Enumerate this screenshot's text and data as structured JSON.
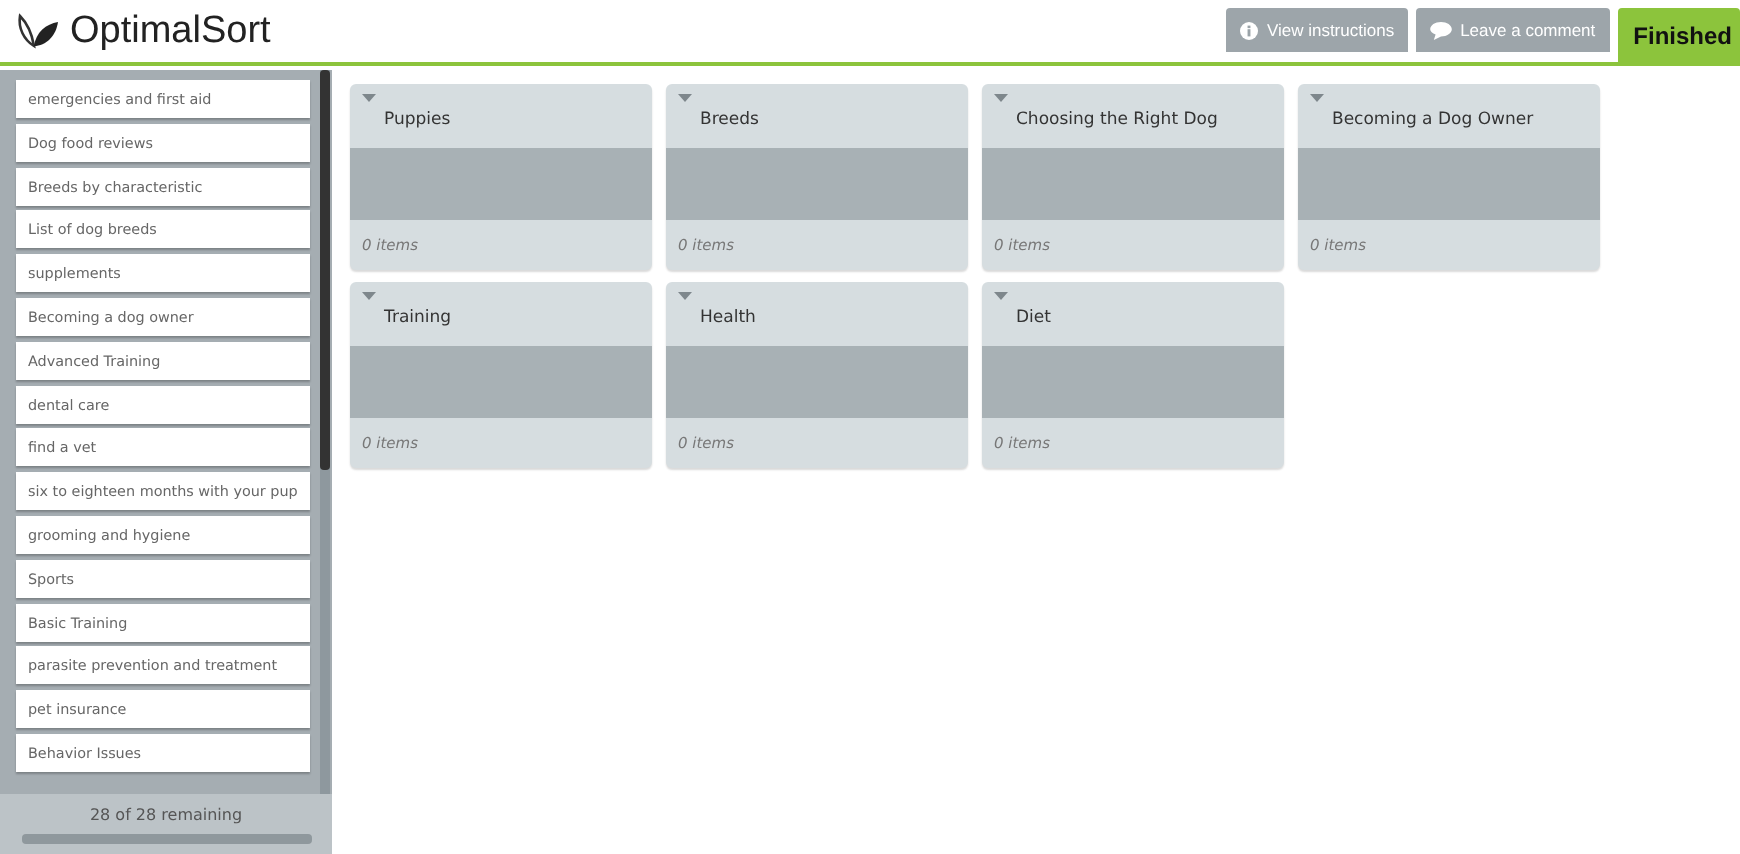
{
  "header": {
    "logo": "OptimalSort",
    "buttons": [
      {
        "kind": "info",
        "label": "View instructions"
      },
      {
        "kind": "comment",
        "label": "Leave a comment"
      },
      {
        "kind": "primary",
        "label": "Finished"
      }
    ]
  },
  "sidebar": {
    "cards": [
      "emergencies and first aid",
      "Dog food reviews",
      "Breeds by characteristic",
      "List of dog breeds",
      "supplements",
      "Becoming a dog owner",
      "Advanced Training",
      "dental care",
      "find a vet",
      "six to eighteen months with your pup",
      "grooming and hygiene",
      "Sports",
      "Basic Training",
      "parasite prevention and treatment",
      "pet insurance",
      "Behavior Issues"
    ],
    "remaining": "28 of 28 remaining"
  },
  "categories": [
    {
      "title": "Puppies",
      "count": "0 items"
    },
    {
      "title": "Breeds",
      "count": "0 items"
    },
    {
      "title": "Choosing the Right Dog",
      "count": "0 items"
    },
    {
      "title": "Becoming a Dog Owner",
      "count": "0 items"
    },
    {
      "title": "Training",
      "count": "0 items"
    },
    {
      "title": "Health",
      "count": "0 items"
    },
    {
      "title": "Diet",
      "count": "0 items"
    }
  ]
}
